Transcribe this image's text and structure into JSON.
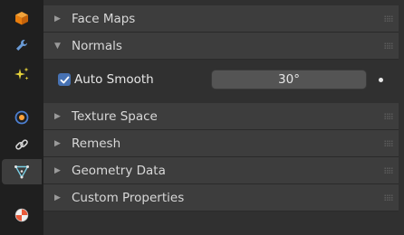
{
  "tabs": [
    {
      "name": "object-tab",
      "icon": "object-orange-cube-icon",
      "color": "#e87d0d"
    },
    {
      "name": "modifier-tab",
      "icon": "wrench-icon",
      "color": "#6a9bd6"
    },
    {
      "name": "particles-tab",
      "icon": "sparkles-icon",
      "color": "#e5d23a"
    },
    {
      "name": "physics-tab",
      "icon": "physics-orbit-icon",
      "color": "#ffa33a"
    },
    {
      "name": "constraints-tab",
      "icon": "link-icon",
      "color": "#cfcfcf"
    },
    {
      "name": "data-tab",
      "icon": "mesh-data-triangle-icon",
      "color": "#7ad0e6",
      "active": true
    },
    {
      "name": "material-tab",
      "icon": "material-sphere-icon",
      "color": "#e87d5a"
    }
  ],
  "panels": [
    {
      "label": "Face Maps",
      "expanded": false
    },
    {
      "label": "Normals",
      "expanded": true
    },
    {
      "label": "Texture Space",
      "expanded": false
    },
    {
      "label": "Remesh",
      "expanded": false
    },
    {
      "label": "Geometry Data",
      "expanded": false
    },
    {
      "label": "Custom Properties",
      "expanded": false
    }
  ],
  "normals": {
    "auto_smooth_label": "Auto Smooth",
    "auto_smooth_checked": true,
    "angle_value": "30°"
  },
  "icons": {
    "collapsed_arrow": "▶",
    "expanded_arrow": "▼"
  },
  "colors": {
    "accent": "#4772b3",
    "background": "#303030",
    "panel_header": "#3d3d3d",
    "tab_strip": "#1f1f1f"
  }
}
